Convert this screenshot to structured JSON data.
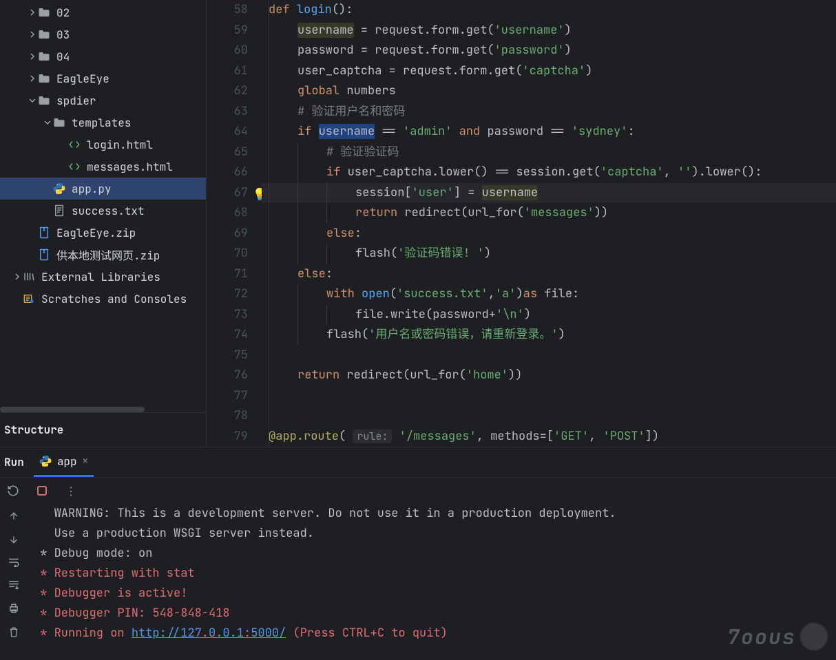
{
  "sidebar": {
    "tree": [
      {
        "indent": 1,
        "chev": "right",
        "icon": "folder",
        "label": "02"
      },
      {
        "indent": 1,
        "chev": "right",
        "icon": "folder",
        "label": "03"
      },
      {
        "indent": 1,
        "chev": "right",
        "icon": "folder",
        "label": "04"
      },
      {
        "indent": 1,
        "chev": "right",
        "icon": "folder",
        "label": "EagleEye"
      },
      {
        "indent": 1,
        "chev": "down",
        "icon": "folder",
        "label": "spdier"
      },
      {
        "indent": 2,
        "chev": "down",
        "icon": "folder",
        "label": "templates"
      },
      {
        "indent": 3,
        "chev": "",
        "icon": "html",
        "label": "login.html"
      },
      {
        "indent": 3,
        "chev": "",
        "icon": "html",
        "label": "messages.html"
      },
      {
        "indent": 2,
        "chev": "",
        "icon": "python",
        "label": "app.py",
        "selected": true
      },
      {
        "indent": 2,
        "chev": "",
        "icon": "text",
        "label": "success.txt"
      },
      {
        "indent": 1,
        "chev": "",
        "icon": "zip",
        "label": "EagleEye.zip"
      },
      {
        "indent": 1,
        "chev": "",
        "icon": "zip",
        "label": "供本地测试网页.zip"
      },
      {
        "indent": 0,
        "chev": "right",
        "icon": "library",
        "label": "External Libraries"
      },
      {
        "indent": 0,
        "chev": "",
        "icon": "scratch",
        "label": "Scratches and Consoles"
      }
    ],
    "structure_header": "Structure"
  },
  "editor": {
    "first_line": 58,
    "current_line": 67,
    "bulb_line": 67,
    "lines": [
      {
        "n": 58,
        "seg": [
          {
            "c": "kw",
            "t": "def "
          },
          {
            "c": "fn",
            "t": "login"
          },
          {
            "c": "op",
            "t": "():"
          }
        ],
        "i": 0
      },
      {
        "n": 59,
        "seg": [
          {
            "c": "hl",
            "t": "username"
          },
          {
            "c": "op",
            "t": " = request.form.get("
          },
          {
            "c": "st",
            "t": "'username'"
          },
          {
            "c": "op",
            "t": ")"
          }
        ],
        "i": 1
      },
      {
        "n": 60,
        "seg": [
          {
            "c": "op",
            "t": "password = request.form.get("
          },
          {
            "c": "st",
            "t": "'password'"
          },
          {
            "c": "op",
            "t": ")"
          }
        ],
        "i": 1
      },
      {
        "n": 61,
        "seg": [
          {
            "c": "op",
            "t": "user_captcha = request.form.get("
          },
          {
            "c": "st",
            "t": "'captcha'"
          },
          {
            "c": "op",
            "t": ")"
          }
        ],
        "i": 1
      },
      {
        "n": 62,
        "seg": [
          {
            "c": "kw",
            "t": "global "
          },
          {
            "c": "op",
            "t": "numbers"
          }
        ],
        "i": 1
      },
      {
        "n": 63,
        "seg": [
          {
            "c": "cm",
            "t": "# 验证用户名和密码"
          }
        ],
        "i": 1
      },
      {
        "n": 64,
        "seg": [
          {
            "c": "kw",
            "t": "if "
          },
          {
            "c": "hlbox",
            "t": "username"
          },
          {
            "c": "op",
            "t": " == "
          },
          {
            "c": "st",
            "t": "'admin'"
          },
          {
            "c": "kw",
            "t": " and "
          },
          {
            "c": "op",
            "t": "password == "
          },
          {
            "c": "st",
            "t": "'sydney'"
          },
          {
            "c": "op",
            "t": ":"
          }
        ],
        "i": 1
      },
      {
        "n": 65,
        "seg": [
          {
            "c": "cm",
            "t": "# 验证验证码"
          }
        ],
        "i": 2
      },
      {
        "n": 66,
        "seg": [
          {
            "c": "kw",
            "t": "if "
          },
          {
            "c": "op",
            "t": "user_captcha.lower() == session.get("
          },
          {
            "c": "st",
            "t": "'captcha'"
          },
          {
            "c": "op",
            "t": ", "
          },
          {
            "c": "st",
            "t": "''"
          },
          {
            "c": "op",
            "t": ").lower():"
          }
        ],
        "i": 2
      },
      {
        "n": 67,
        "seg": [
          {
            "c": "op",
            "t": "session["
          },
          {
            "c": "st",
            "t": "'user'"
          },
          {
            "c": "op",
            "t": "] = "
          },
          {
            "c": "hl",
            "t": "username"
          }
        ],
        "i": 3
      },
      {
        "n": 68,
        "seg": [
          {
            "c": "kw",
            "t": "return "
          },
          {
            "c": "op",
            "t": "redirect(url_for("
          },
          {
            "c": "st",
            "t": "'messages'"
          },
          {
            "c": "op",
            "t": "))"
          }
        ],
        "i": 3
      },
      {
        "n": 69,
        "seg": [
          {
            "c": "kw",
            "t": "else"
          },
          {
            "c": "op",
            "t": ":"
          }
        ],
        "i": 2
      },
      {
        "n": 70,
        "seg": [
          {
            "c": "op",
            "t": "flash("
          },
          {
            "c": "st",
            "t": "'验证码错误! '"
          },
          {
            "c": "op",
            "t": ")"
          }
        ],
        "i": 3
      },
      {
        "n": 71,
        "seg": [
          {
            "c": "kw",
            "t": "else"
          },
          {
            "c": "op",
            "t": ":"
          }
        ],
        "i": 1
      },
      {
        "n": 72,
        "seg": [
          {
            "c": "kw",
            "t": "with "
          },
          {
            "c": "fn",
            "t": "open"
          },
          {
            "c": "op",
            "t": "("
          },
          {
            "c": "st",
            "t": "'success.txt'"
          },
          {
            "c": "op",
            "t": ","
          },
          {
            "c": "st",
            "t": "'a'"
          },
          {
            "c": "op",
            "t": ")"
          },
          {
            "c": "kw",
            "t": "as "
          },
          {
            "c": "op",
            "t": "file:"
          }
        ],
        "i": 2
      },
      {
        "n": 73,
        "seg": [
          {
            "c": "op",
            "t": "file.write(password+"
          },
          {
            "c": "st",
            "t": "'\\n'"
          },
          {
            "c": "op",
            "t": ")"
          }
        ],
        "i": 3
      },
      {
        "n": 74,
        "seg": [
          {
            "c": "op",
            "t": "flash("
          },
          {
            "c": "st",
            "t": "'用户名或密码错误，请重新登录。'"
          },
          {
            "c": "op",
            "t": ")"
          }
        ],
        "i": 2
      },
      {
        "n": 75,
        "seg": [],
        "i": 0
      },
      {
        "n": 76,
        "seg": [
          {
            "c": "kw",
            "t": "return "
          },
          {
            "c": "op",
            "t": "redirect(url_for("
          },
          {
            "c": "st",
            "t": "'home'"
          },
          {
            "c": "op",
            "t": "))"
          }
        ],
        "i": 1
      },
      {
        "n": 77,
        "seg": [],
        "i": 0
      },
      {
        "n": 78,
        "seg": [],
        "i": 0
      },
      {
        "n": 79,
        "seg": [
          {
            "c": "dec",
            "t": "@app.route"
          },
          {
            "c": "op",
            "t": "( "
          },
          {
            "c": "hint",
            "t": "rule:"
          },
          {
            "c": "op",
            "t": " "
          },
          {
            "c": "st",
            "t": "'/messages'"
          },
          {
            "c": "op",
            "t": ", "
          },
          {
            "c": "par",
            "t": "methods"
          },
          {
            "c": "op",
            "t": "=["
          },
          {
            "c": "st",
            "t": "'GET'"
          },
          {
            "c": "op",
            "t": ", "
          },
          {
            "c": "st",
            "t": "'POST'"
          },
          {
            "c": "op",
            "t": "])"
          }
        ],
        "i": 0
      }
    ]
  },
  "run_panel": {
    "title": "Run",
    "tab_label": "app",
    "console": [
      {
        "cls": "warn",
        "t": "   WARNING: This is a development server. Do not use it in a production deployment."
      },
      {
        "cls": "warn",
        "t": "   Use a production WSGI server instead."
      },
      {
        "cls": "warn",
        "t": " * Debug mode: on"
      },
      {
        "cls": "redln",
        "t": " * Restarting with stat"
      },
      {
        "cls": "redln",
        "t": " * Debugger is active!"
      },
      {
        "cls": "redln",
        "t": " * Debugger PIN: 548-848-418"
      },
      {
        "cls": "redln",
        "t": " * Running on ",
        "link": "http://127.0.0.1:5000/",
        "after": " (Press CTRL+C to quit)"
      }
    ]
  },
  "watermark": "7oous"
}
